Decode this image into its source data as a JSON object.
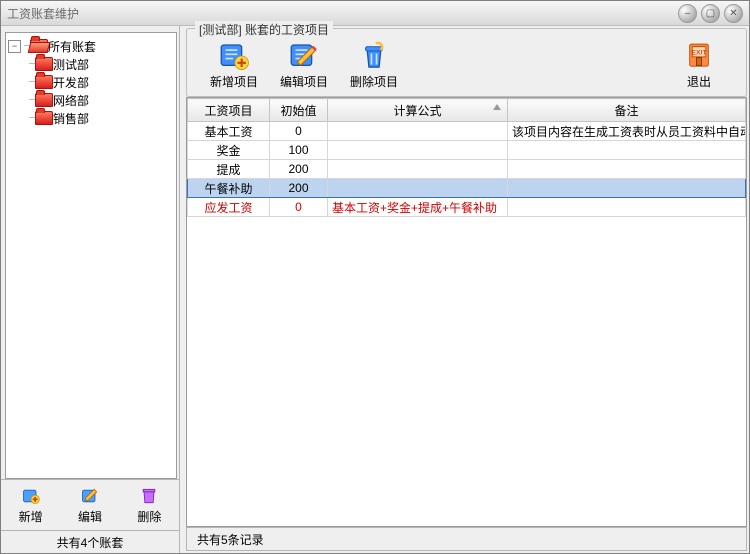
{
  "window": {
    "title": "工资账套维护"
  },
  "sidebar": {
    "root": {
      "label": "所有账套",
      "expanded": true
    },
    "items": [
      {
        "label": "测试部"
      },
      {
        "label": "开发部"
      },
      {
        "label": "网络部"
      },
      {
        "label": "销售部"
      }
    ],
    "toolbar": {
      "add": "新增",
      "edit": "编辑",
      "del": "删除"
    },
    "status": "共有4个账套"
  },
  "main": {
    "group_title": "[测试部] 账套的工资项目",
    "toolbar": {
      "add": "新增项目",
      "edit": "编辑项目",
      "del": "删除项目",
      "exit": "退出"
    },
    "columns": {
      "c1": "工资项目",
      "c2": "初始值",
      "c3": "计算公式",
      "c4": "备注"
    },
    "rows": [
      {
        "name": "基本工资",
        "init": "0",
        "formula": "",
        "note": "该项目内容在生成工资表时从员工资料中自动导入",
        "selected": false,
        "red": false
      },
      {
        "name": "奖金",
        "init": "100",
        "formula": "",
        "note": "",
        "selected": false,
        "red": false
      },
      {
        "name": "提成",
        "init": "200",
        "formula": "",
        "note": "",
        "selected": false,
        "red": false
      },
      {
        "name": "午餐补助",
        "init": "200",
        "formula": "",
        "note": "",
        "selected": true,
        "red": false
      },
      {
        "name": "应发工资",
        "init": "0",
        "formula": "基本工资+奖金+提成+午餐补助",
        "note": "",
        "selected": false,
        "red": true
      }
    ],
    "status": "共有5条记录"
  }
}
